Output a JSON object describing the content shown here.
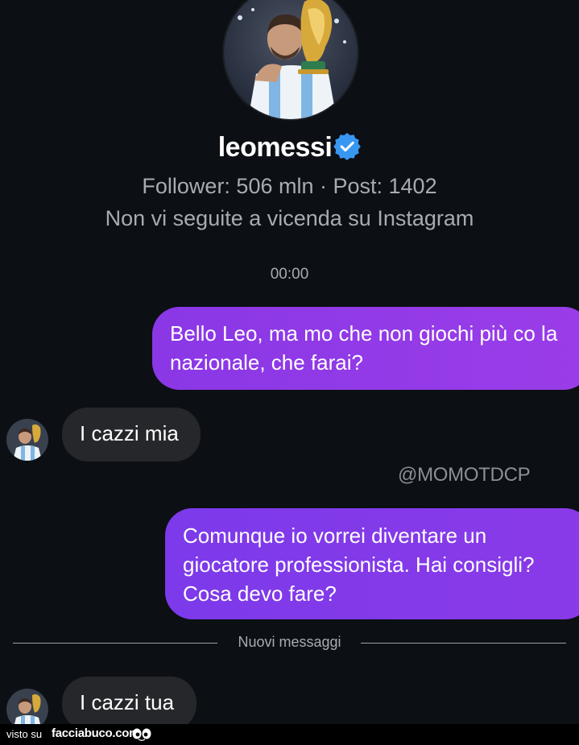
{
  "profile": {
    "username": "leomessi",
    "stats": "Follower: 506 mln · Post: 1402",
    "follow_status": "Non vi seguite a vicenda su Instagram"
  },
  "conversation": {
    "timestamp": "00:00",
    "messages": [
      {
        "sender": "me",
        "text": "Bello Leo, ma mo che non giochi più co la nazionale, che farai?"
      },
      {
        "sender": "leomessi",
        "text": "I cazzi mia"
      },
      {
        "sender": "me",
        "text": "Comunque io vorrei diventare un giocatore professionista. Hai consigli? Cosa devo fare?"
      },
      {
        "sender": "leomessi",
        "text": "I cazzi tua"
      }
    ],
    "new_messages_divider": "Nuovi messaggi"
  },
  "watermark": "@MOMOTDCP",
  "footer": {
    "visto_su": "visto su",
    "brand": "facciabuco.com"
  },
  "colors": {
    "background": "#0c0f14",
    "outgoing_bubble": "#9a3de8",
    "incoming_bubble": "#25272b",
    "verified_badge": "#3897f0",
    "secondary_text": "#a8abb2"
  },
  "icons": [
    "verified-badge-icon",
    "eyes-icon"
  ]
}
